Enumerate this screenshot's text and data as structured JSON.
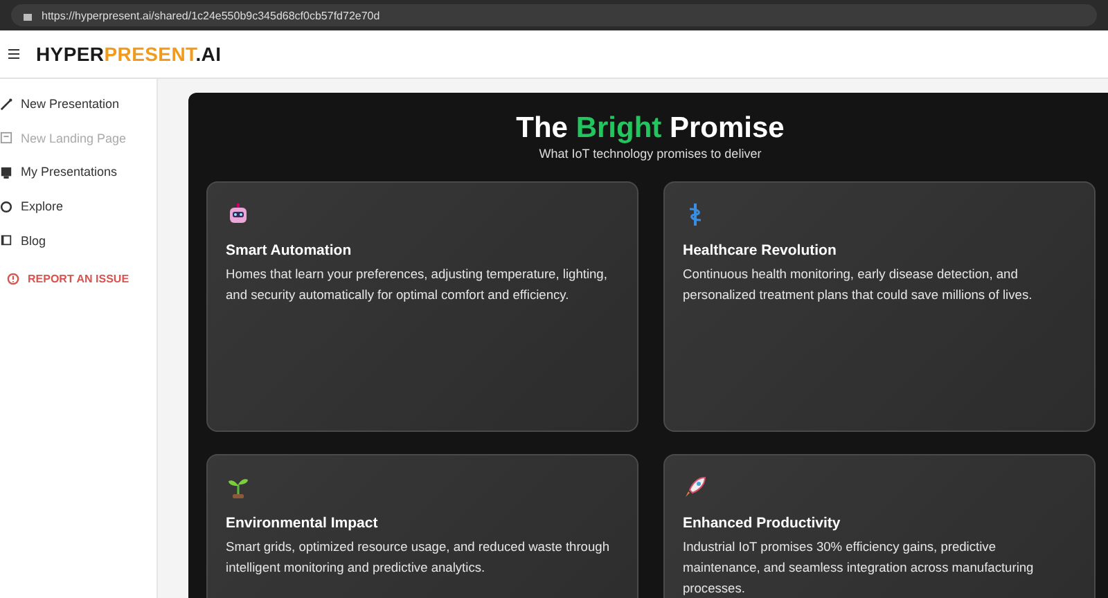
{
  "browser": {
    "url": "https://hyperpresent.ai/shared/1c24e550b9c345d68cf0cb57fd72e70d"
  },
  "brand": {
    "parts": [
      {
        "text": "HYPER",
        "color": "#1a1a1a"
      },
      {
        "text": "PRESENT",
        "color": "#f29a1c"
      },
      {
        "text": ".AI",
        "color": "#1a1a1a"
      }
    ]
  },
  "sidebar": {
    "items": [
      {
        "label": "New Presentation",
        "kind": "wand",
        "disabled": false
      },
      {
        "label": "New Landing Page",
        "kind": "page",
        "disabled": true
      },
      {
        "label": "My Presentations",
        "kind": "deck",
        "disabled": false
      },
      {
        "label": "Explore",
        "kind": "compass",
        "disabled": false
      },
      {
        "label": "Blog",
        "kind": "book",
        "disabled": false
      }
    ],
    "report": "REPORT AN ISSUE"
  },
  "slide": {
    "title": [
      {
        "text": "The ",
        "accent": false
      },
      {
        "text": "Bright",
        "accent": true
      },
      {
        "text": " Promise",
        "accent": false
      }
    ],
    "subtitle": "What IoT technology promises to deliver",
    "cards": [
      {
        "kind": "robot",
        "title": "Smart Automation",
        "text": "Homes that learn your preferences, adjusting temperature, lighting, and security automatically for optimal comfort and efficiency."
      },
      {
        "kind": "caduceus",
        "title": "Healthcare Revolution",
        "text": "Continuous health monitoring, early disease detection, and personalized treatment plans that could save millions of lives."
      },
      {
        "kind": "sprout",
        "title": "Environmental Impact",
        "text": "Smart grids, optimized resource usage, and reduced waste through intelligent monitoring and predictive analytics."
      },
      {
        "kind": "rocket",
        "title": "Enhanced Productivity",
        "text": "Industrial IoT promises 30% efficiency gains, predictive maintenance, and seamless integration across manufacturing processes."
      }
    ]
  }
}
